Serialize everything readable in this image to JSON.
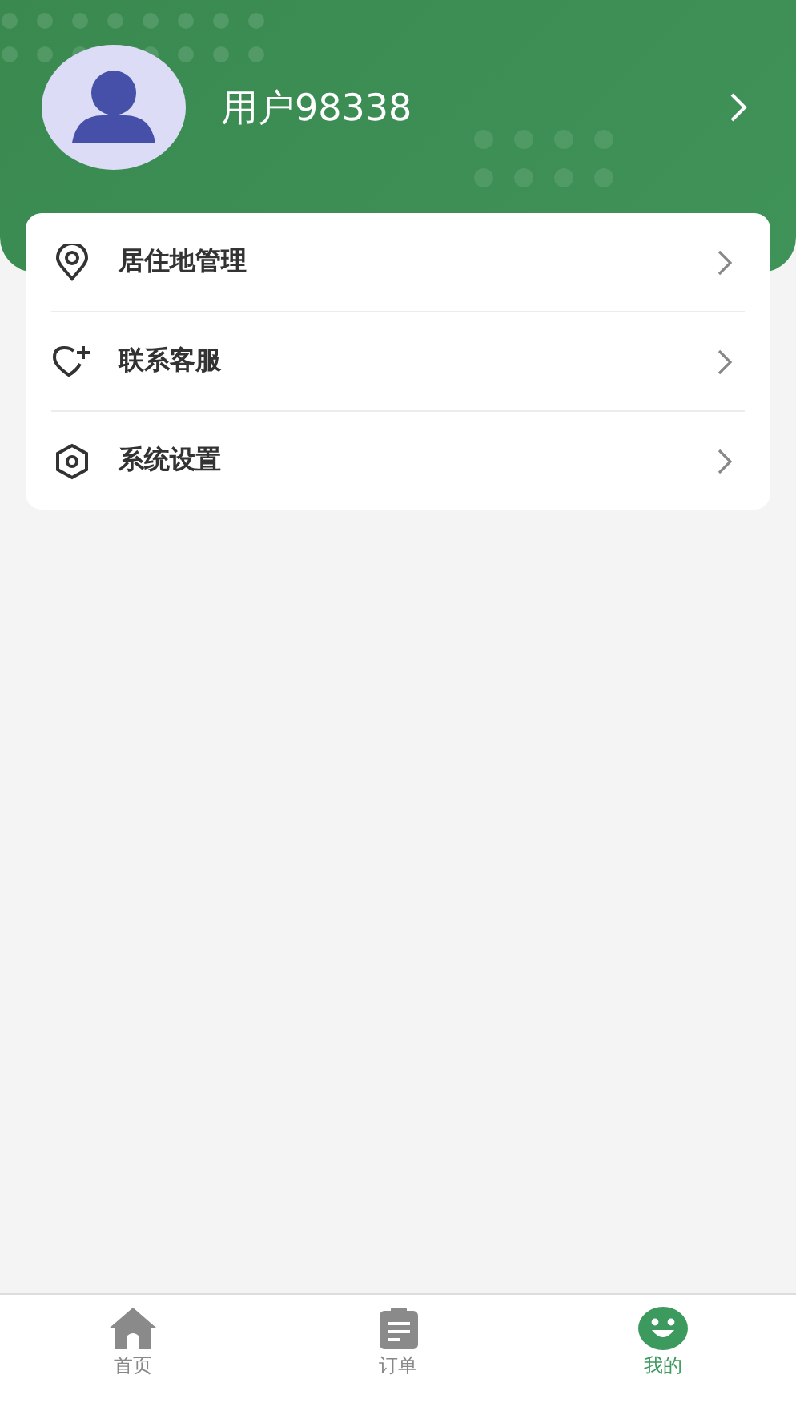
{
  "profile": {
    "username": "用户98338"
  },
  "menu": [
    {
      "kind": "location",
      "label": "居住地管理"
    },
    {
      "kind": "heart",
      "label": "联系客服"
    },
    {
      "kind": "settings",
      "label": "系统设置"
    }
  ],
  "tabs": [
    {
      "kind": "home",
      "label": "首页",
      "selected": false
    },
    {
      "kind": "orders",
      "label": "订单",
      "selected": false
    },
    {
      "kind": "mine",
      "label": "我的",
      "selected": true
    }
  ]
}
